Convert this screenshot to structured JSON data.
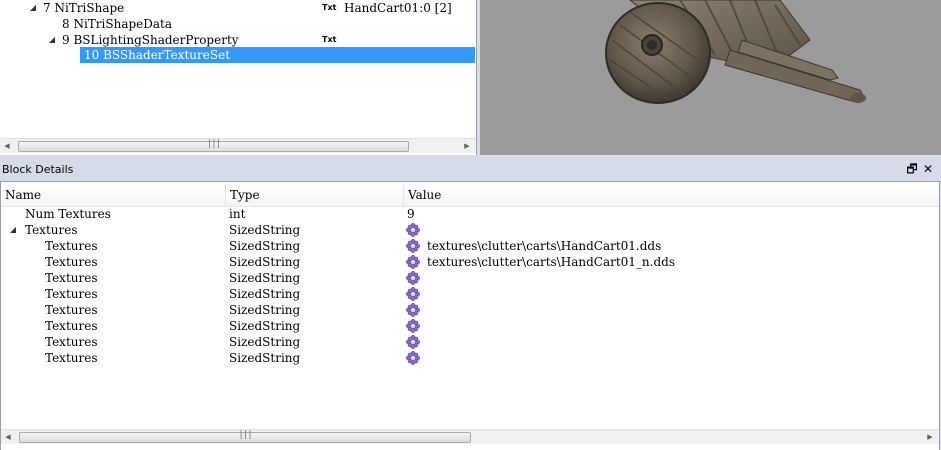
{
  "block_list": {
    "rows": [
      {
        "label": "7 NiTriShape",
        "expander": "◢",
        "badge": "Txt",
        "value": "HandCart01:0 [2]"
      },
      {
        "label": "8 NiTriShapeData",
        "expander": "",
        "badge": "",
        "value": ""
      },
      {
        "label": "9 BSLightingShaderProperty",
        "expander": "◢",
        "badge": "Txt",
        "value": ""
      },
      {
        "label": "10 BSShaderTextureSet",
        "expander": "",
        "badge": "",
        "value": ""
      }
    ],
    "scroll": {
      "left": "◀",
      "right": "▶",
      "grip": "|||"
    }
  },
  "block_details": {
    "title": "Block Details",
    "float_button": "🗗",
    "close_button": "✕",
    "columns": {
      "name": "Name",
      "type": "Type",
      "value": "Value"
    },
    "rows": [
      {
        "name": "Num Textures",
        "type": "int",
        "value": "9",
        "expander": "",
        "has_icon": false
      },
      {
        "name": "Textures",
        "type": "SizedString",
        "value": "",
        "expander": "◢",
        "has_icon": true
      },
      {
        "name": "Textures",
        "type": "SizedString",
        "value": "textures\\clutter\\carts\\HandCart01.dds",
        "expander": "",
        "has_icon": true
      },
      {
        "name": "Textures",
        "type": "SizedString",
        "value": "textures\\clutter\\carts\\HandCart01_n.dds",
        "expander": "",
        "has_icon": true
      },
      {
        "name": "Textures",
        "type": "SizedString",
        "value": "",
        "expander": "",
        "has_icon": true
      },
      {
        "name": "Textures",
        "type": "SizedString",
        "value": "",
        "expander": "",
        "has_icon": true
      },
      {
        "name": "Textures",
        "type": "SizedString",
        "value": "",
        "expander": "",
        "has_icon": true
      },
      {
        "name": "Textures",
        "type": "SizedString",
        "value": "",
        "expander": "",
        "has_icon": true
      },
      {
        "name": "Textures",
        "type": "SizedString",
        "value": "",
        "expander": "",
        "has_icon": true
      },
      {
        "name": "Textures",
        "type": "SizedString",
        "value": "",
        "expander": "",
        "has_icon": true
      }
    ],
    "scroll": {
      "left": "◀",
      "right": "▶",
      "grip": "|||"
    }
  },
  "colors": {
    "selection": "#3399ff",
    "viewport_bg": "#9b9b9b",
    "dock_bg": "#d6dbe9"
  }
}
